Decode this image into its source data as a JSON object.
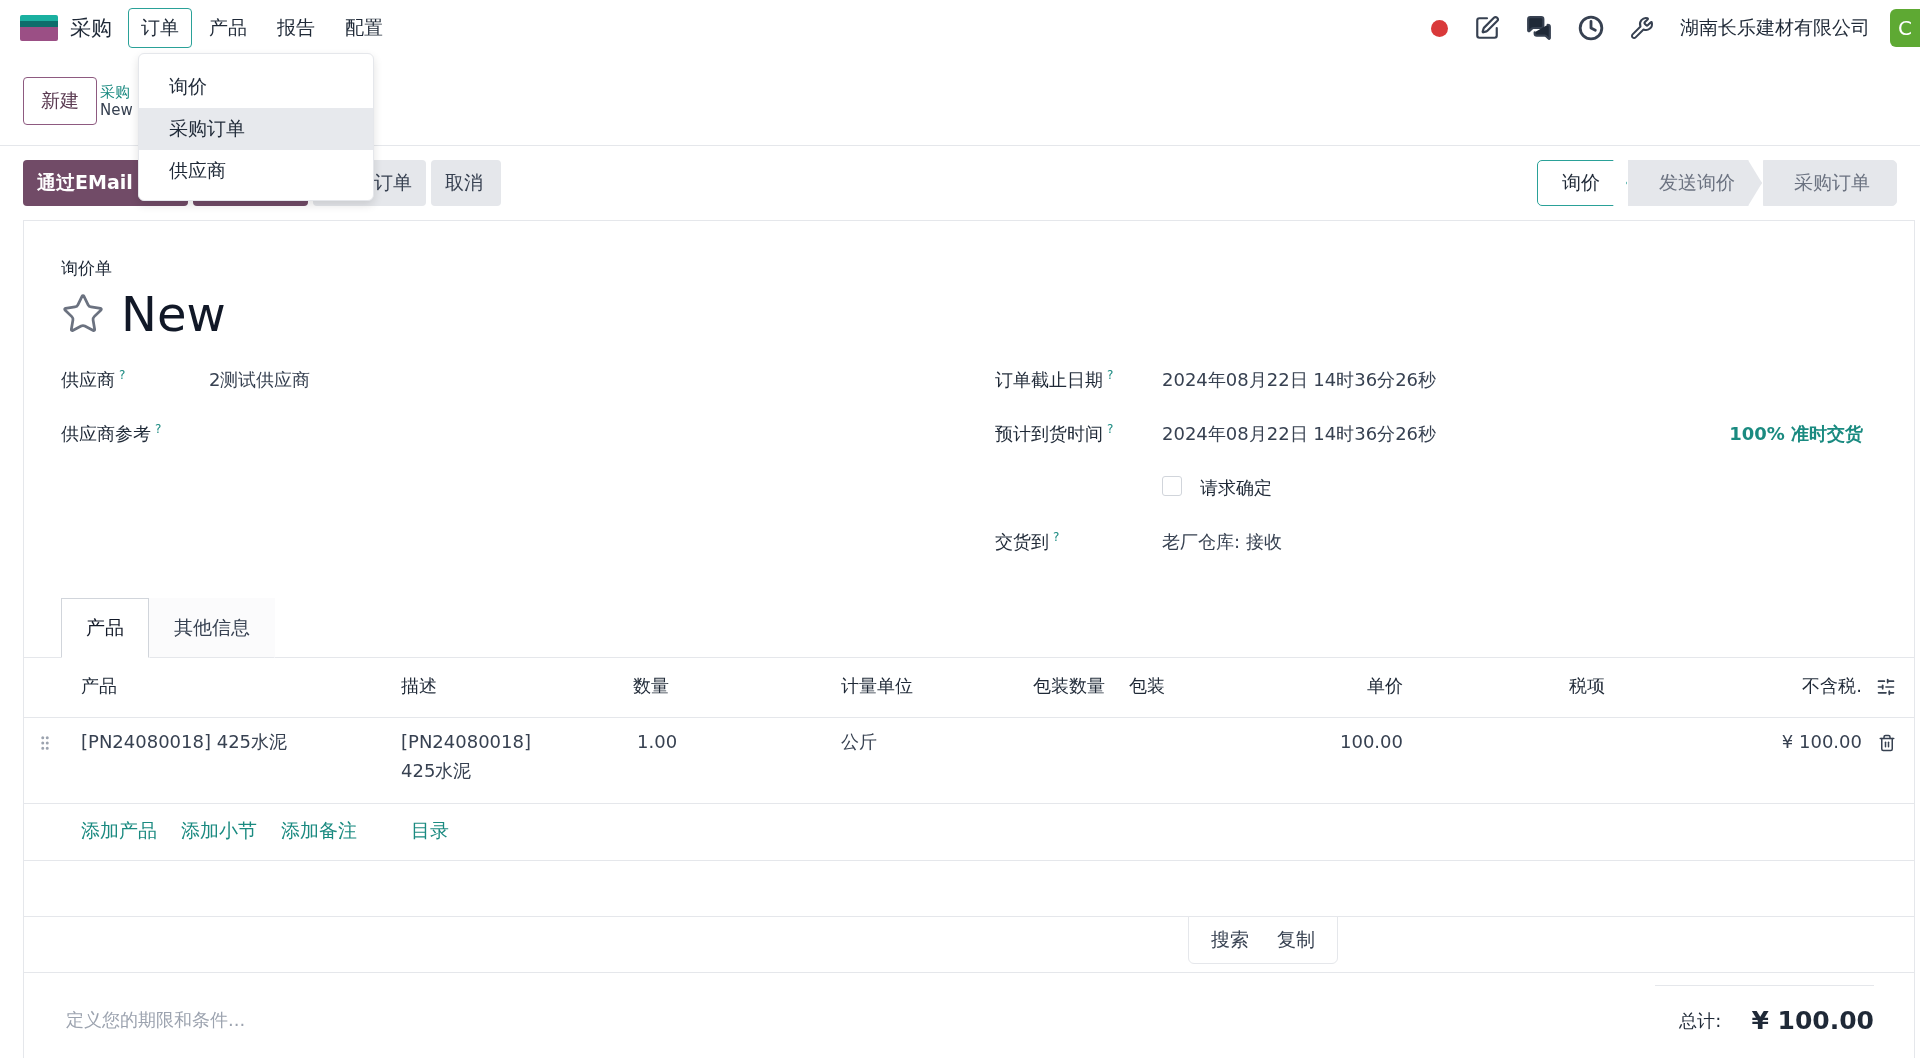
{
  "navbar": {
    "app": "采购",
    "menus": [
      {
        "label": "订单",
        "selected": true
      },
      {
        "label": "产品",
        "selected": false
      },
      {
        "label": "报告",
        "selected": false
      },
      {
        "label": "配置",
        "selected": false
      }
    ],
    "company": "湖南长乐建材有限公司",
    "avatar": "C"
  },
  "dropdown": {
    "items": [
      {
        "label": "询价",
        "selected": false
      },
      {
        "label": "采购订单",
        "selected": true
      },
      {
        "label": "供应商",
        "selected": false
      }
    ]
  },
  "control_panel": {
    "new_button": "新建",
    "breadcrumb": [
      "采购",
      "New"
    ]
  },
  "actions": [
    {
      "label": "通过EMail",
      "kind": "primary"
    },
    {
      "kind": "primary"
    },
    {
      "label": "订单",
      "kind": "secondary"
    },
    {
      "label": "取消",
      "kind": "secondary"
    }
  ],
  "status_steps": [
    {
      "label": "询价",
      "selected": true
    },
    {
      "label": "发送询价",
      "selected": false
    },
    {
      "label": "采购订单",
      "selected": false
    }
  ],
  "form": {
    "subtitle": "询价单",
    "title": "New",
    "favorite": false,
    "left_fields": [
      {
        "label": "供应商",
        "help": "?",
        "value": "2测试供应商"
      },
      {
        "label": "供应商参考",
        "help": "?"
      }
    ],
    "right_fields": [
      {
        "kind": "text",
        "label": "订单截止日期",
        "help": "?",
        "value": "2024年08月22日 14时36分26秒"
      },
      {
        "kind": "text",
        "label": "预计到货时间",
        "help": "?",
        "value": "2024年08月22日 14时36分26秒",
        "note": "100% 准时交货"
      },
      {
        "kind": "checkbox",
        "label": "请求确定",
        "checked": false
      },
      {
        "kind": "text",
        "label": "交货到",
        "help": "?",
        "value": "老厂仓库: 接收"
      }
    ]
  },
  "tabs": [
    {
      "label": "产品",
      "selected": true
    },
    {
      "label": "其他信息",
      "selected": false
    }
  ],
  "table": {
    "columns": [
      "产品",
      "描述",
      "数量",
      "计量单位",
      "包装数量",
      "包装",
      "单价",
      "税项",
      "不含税."
    ],
    "rows": [
      [
        "[PN24080018] 425水泥",
        "[PN24080018] 425水泥",
        "1.00",
        "公斤",
        "",
        "",
        "100.00",
        "",
        "¥ 100.00"
      ]
    ],
    "add_links": [
      "添加产品",
      "添加小节",
      "添加备注",
      "目录"
    ]
  },
  "popup_buttons": [
    "搜索",
    "复制"
  ],
  "footer": {
    "terms_placeholder": "定义您的期限和条件...",
    "total_label": "总计:",
    "total_value": "¥ 100.00"
  }
}
